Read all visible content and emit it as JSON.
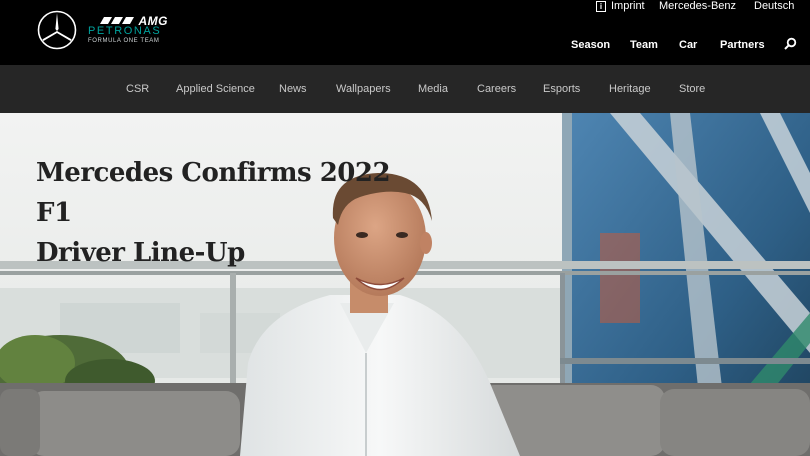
{
  "header": {
    "logo_icon": "mercedes-star-icon",
    "brand": {
      "amg": "AMG",
      "petronas": "PETRONAS",
      "team": "FORMULA ONE TEAM"
    },
    "utility": {
      "imprint": "Imprint",
      "mercedes_benz": "Mercedes-Benz",
      "language": "Deutsch"
    },
    "nav": [
      "Season",
      "Team",
      "Car",
      "Partners"
    ],
    "search_icon": "search-icon"
  },
  "subnav": [
    "CSR",
    "Applied Science",
    "News",
    "Wallpapers",
    "Media",
    "Careers",
    "Esports",
    "Heritage",
    "Store"
  ],
  "hero": {
    "headline_line1": "Mercedes Confirms 2022 F1",
    "headline_line2": "Driver Line-Up"
  },
  "colors": {
    "header_bg": "#000000",
    "subnav_bg": "#262626",
    "petronas_teal": "#00a19c",
    "headline": "#222222"
  }
}
